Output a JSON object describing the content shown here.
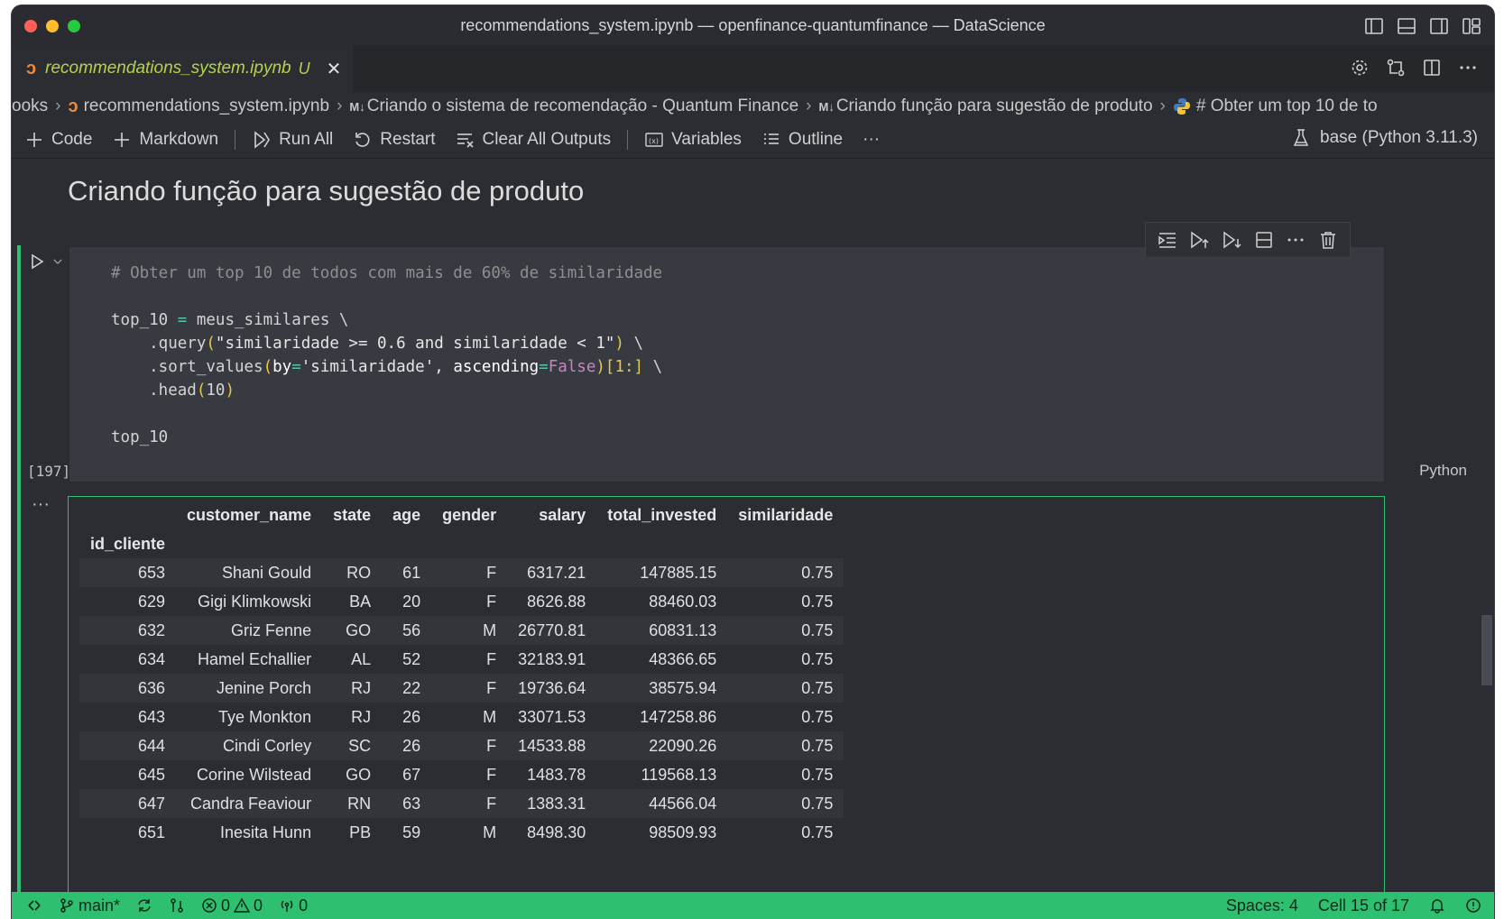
{
  "window": {
    "title": "recommendations_system.ipynb — openfinance-quantumfinance — DataScience"
  },
  "tab": {
    "label": "recommendations_system.ipynb",
    "modified": "U"
  },
  "breadcrumb": [
    "ooks",
    "recommendations_system.ipynb",
    "Criando o sistema de recomendação - Quantum Finance",
    "Criando função para sugestão de produto",
    "# Obter um top 10 de to"
  ],
  "toolbar": {
    "code": "Code",
    "markdown": "Markdown",
    "run_all": "Run All",
    "restart": "Restart",
    "clear_outputs": "Clear All Outputs",
    "variables": "Variables",
    "outline": "Outline",
    "more": "···",
    "kernel": "base (Python 3.11.3)"
  },
  "markdown_cell": {
    "heading": "Criando função para sugestão de produto"
  },
  "code_cell": {
    "comment": "# Obter um top 10 de todos com mais de 60% de similaridade",
    "line2_var": "top_10",
    "line2_op": "=",
    "line2_rest": " meus_similares \\",
    "line3_a": "    .query",
    "line3_p1": "(",
    "line3_str": "\"similaridade >= 0.6 and similaridade < 1\"",
    "line3_p2": ")",
    "line3_end": " \\",
    "line4_a": "    .sort_values",
    "line4_p1": "(",
    "line4_k1": "by",
    "line4_eq1": "=",
    "line4_s1": "'similaridade', ",
    "line4_k2": "ascending",
    "line4_eq2": "=",
    "line4_false": "False",
    "line4_p2": ")[1:]",
    "line4_end": " \\",
    "line5_a": "    .head",
    "line5_p1": "(",
    "line5_num": "10",
    "line5_p2": ")",
    "line7": "top_10",
    "exec_count": "[197]",
    "language": "Python"
  },
  "output": {
    "dots": "···",
    "index_name": "id_cliente",
    "columns": [
      "customer_name",
      "state",
      "age",
      "gender",
      "salary",
      "total_invested",
      "similaridade"
    ],
    "rows": [
      [
        "653",
        "Shani Gould",
        "RO",
        "61",
        "F",
        "6317.21",
        "147885.15",
        "0.75"
      ],
      [
        "629",
        "Gigi Klimkowski",
        "BA",
        "20",
        "F",
        "8626.88",
        "88460.03",
        "0.75"
      ],
      [
        "632",
        "Griz Fenne",
        "GO",
        "56",
        "M",
        "26770.81",
        "60831.13",
        "0.75"
      ],
      [
        "634",
        "Hamel Echallier",
        "AL",
        "52",
        "F",
        "32183.91",
        "48366.65",
        "0.75"
      ],
      [
        "636",
        "Jenine Porch",
        "RJ",
        "22",
        "F",
        "19736.64",
        "38575.94",
        "0.75"
      ],
      [
        "643",
        "Tye Monkton",
        "RJ",
        "26",
        "M",
        "33071.53",
        "147258.86",
        "0.75"
      ],
      [
        "644",
        "Cindi Corley",
        "SC",
        "26",
        "F",
        "14533.88",
        "22090.26",
        "0.75"
      ],
      [
        "645",
        "Corine Wilstead",
        "GO",
        "67",
        "F",
        "1483.78",
        "119568.13",
        "0.75"
      ],
      [
        "647",
        "Candra Feaviour",
        "RN",
        "63",
        "F",
        "1383.31",
        "44566.04",
        "0.75"
      ],
      [
        "651",
        "Inesita Hunn",
        "PB",
        "59",
        "M",
        "8498.30",
        "98509.93",
        "0.75"
      ]
    ]
  },
  "statusbar": {
    "branch": "main*",
    "errors": "0",
    "warnings": "0",
    "ports": "0",
    "spaces": "Spaces: 4",
    "cell_position": "Cell 15 of 17"
  },
  "colors": {
    "accent": "#2fbf71",
    "tab_label": "#b2d34b",
    "notebook_icon": "#f0893a"
  }
}
